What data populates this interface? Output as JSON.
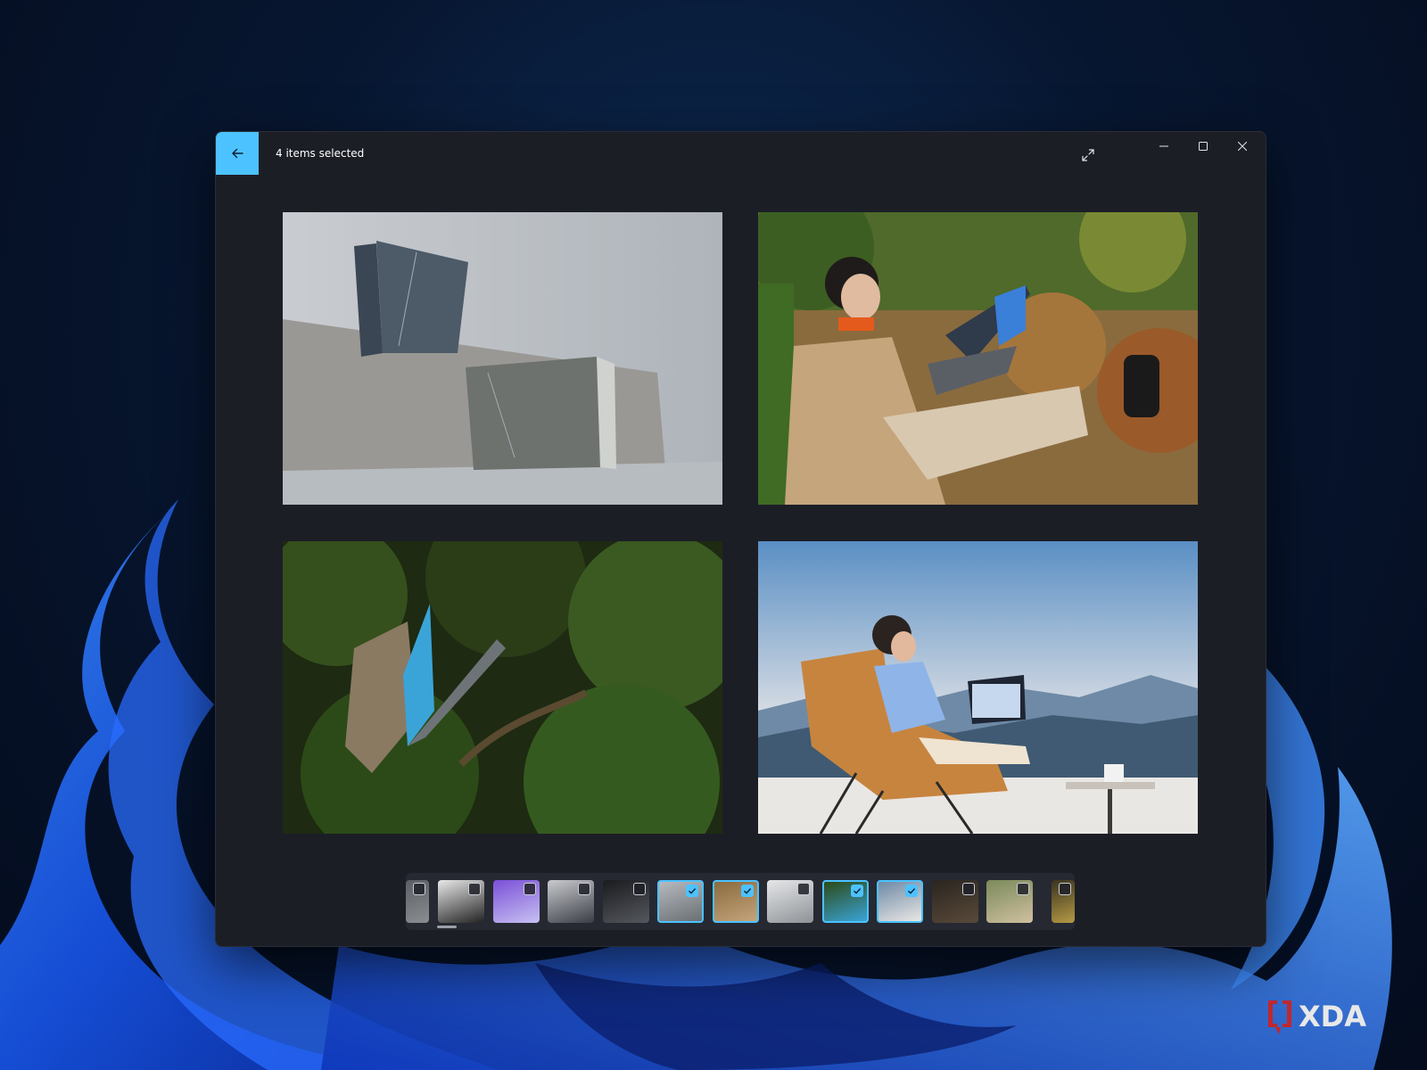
{
  "window": {
    "title": "4 items selected"
  },
  "colors": {
    "accent": "#4cc2ff",
    "window_bg": "#1c1e26",
    "filmstrip_bg": "#262932"
  },
  "icons": {
    "back": "arrow-left-icon",
    "fullscreen": "expand-icon",
    "minimize": "minimize-icon",
    "maximize": "maximize-icon",
    "close": "close-icon",
    "checkbox": "checkbox-icon",
    "checkmark": "checkmark-icon"
  },
  "filmstrip": {
    "thumbnails": [
      {
        "selected": false
      },
      {
        "selected": false
      },
      {
        "selected": false
      },
      {
        "selected": false
      },
      {
        "selected": false
      },
      {
        "selected": true
      },
      {
        "selected": true
      },
      {
        "selected": false
      },
      {
        "selected": true
      },
      {
        "selected": true
      },
      {
        "selected": false
      },
      {
        "selected": false
      },
      {
        "selected": false
      }
    ]
  },
  "watermark": {
    "brand": "XDA"
  }
}
